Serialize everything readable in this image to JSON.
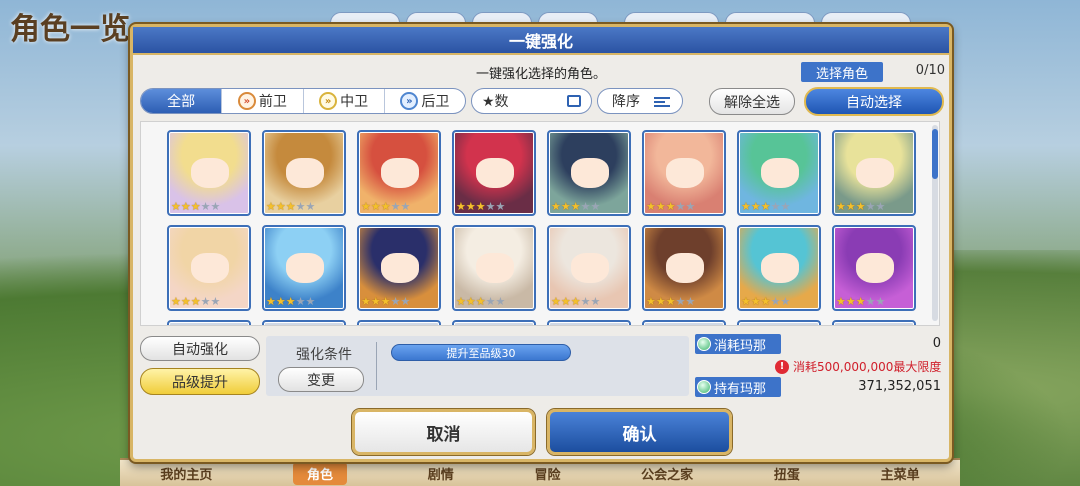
{
  "background": {
    "title": "角色一览",
    "bottom_nav": [
      "我的主页",
      "角色",
      "剧情",
      "冒险",
      "公会之家",
      "扭蛋",
      "主菜单"
    ],
    "bottom_nav_active": "角色"
  },
  "dialog": {
    "title": "一键强化",
    "subtitle": "一键强化选择的角色。",
    "select_label": "选择角色",
    "select_count": "0/10",
    "filter_tabs": [
      {
        "label": "全部",
        "active": true,
        "icon": ""
      },
      {
        "label": "前卫",
        "active": false,
        "icon": "vanguard-icon"
      },
      {
        "label": "中卫",
        "active": false,
        "icon": "midguard-icon"
      },
      {
        "label": "后卫",
        "active": false,
        "icon": "rearguard-icon"
      }
    ],
    "sort_field": "★数",
    "order_label": "降序",
    "deselect_all": "解除全选",
    "auto_select": "自动选择",
    "characters": [
      {
        "stars": 3,
        "max_stars": 5,
        "hair": "#f2dd8e",
        "bg": "#d9c2e8"
      },
      {
        "stars": 3,
        "max_stars": 5,
        "hair": "#c58a3d",
        "bg": "#e8d0a0"
      },
      {
        "stars": 3,
        "max_stars": 5,
        "hair": "#d6503f",
        "bg": "#f0b26a"
      },
      {
        "stars": 3,
        "max_stars": 5,
        "hair": "#d2334d",
        "bg": "#6a2d46"
      },
      {
        "stars": 3,
        "max_stars": 5,
        "hair": "#2d3f5e",
        "bg": "#7da59b"
      },
      {
        "stars": 3,
        "max_stars": 5,
        "hair": "#f2b79a",
        "bg": "#d98072"
      },
      {
        "stars": 3,
        "max_stars": 5,
        "hair": "#57c497",
        "bg": "#6fb6e0"
      },
      {
        "stars": 3,
        "max_stars": 5,
        "hair": "#e8e29a",
        "bg": "#7a9a8a"
      },
      {
        "stars": 3,
        "max_stars": 5,
        "hair": "#f1d5a6",
        "bg": "#f4d6c6"
      },
      {
        "stars": 3,
        "max_stars": 5,
        "hair": "#8dd0f4",
        "bg": "#3d82c9"
      },
      {
        "stars": 3,
        "max_stars": 5,
        "hair": "#2a2f6a",
        "bg": "#d88f3c"
      },
      {
        "stars": 3,
        "max_stars": 5,
        "hair": "#f4ede2",
        "bg": "#c9b9a6"
      },
      {
        "stars": 3,
        "max_stars": 5,
        "hair": "#ece6de",
        "bg": "#e8c6b2"
      },
      {
        "stars": 3,
        "max_stars": 5,
        "hair": "#6e3f2c",
        "bg": "#cf8a45"
      },
      {
        "stars": 3,
        "max_stars": 5,
        "hair": "#55c4d4",
        "bg": "#e6a94a"
      },
      {
        "stars": 3,
        "max_stars": 5,
        "hair": "#8a3cb4",
        "bg": "#c65fd6"
      }
    ],
    "auto_enhance": "自动强化",
    "rank_up": "品级提升",
    "condition_label": "强化条件",
    "change": "变更",
    "condition_value": "提升至品级30",
    "mana_cost_label": "消耗玛那",
    "mana_cost_value": "0",
    "mana_warning": "消耗500,000,000最大限度",
    "mana_owned_label": "持有玛那",
    "mana_owned_value": "371,352,051",
    "cancel": "取消",
    "confirm": "确认"
  }
}
